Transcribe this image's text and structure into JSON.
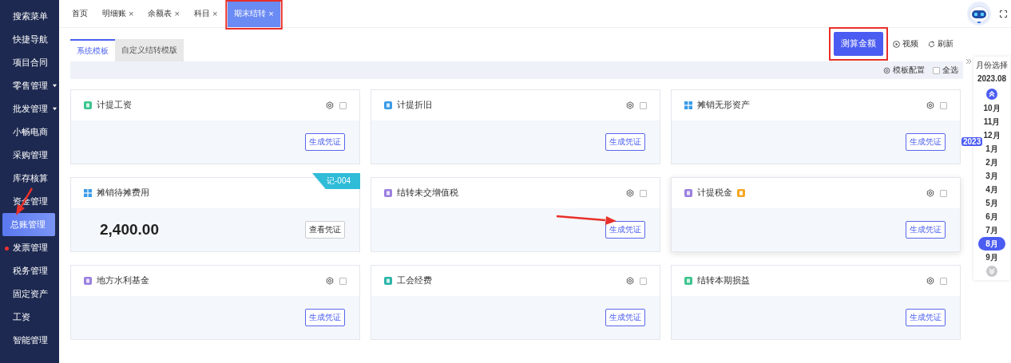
{
  "sidebar": {
    "items": [
      {
        "label": "搜索菜单",
        "selected": false,
        "expandable": false,
        "alert": false
      },
      {
        "label": "快捷导航",
        "selected": false,
        "expandable": false,
        "alert": false
      },
      {
        "label": "项目合同",
        "selected": false,
        "expandable": false,
        "alert": false
      },
      {
        "label": "零售管理",
        "selected": false,
        "expandable": true,
        "alert": false
      },
      {
        "label": "批发管理",
        "selected": false,
        "expandable": true,
        "alert": false
      },
      {
        "label": "小畅电商",
        "selected": false,
        "expandable": false,
        "alert": false
      },
      {
        "label": "采购管理",
        "selected": false,
        "expandable": false,
        "alert": false
      },
      {
        "label": "库存核算",
        "selected": false,
        "expandable": false,
        "alert": false
      },
      {
        "label": "资金管理",
        "selected": false,
        "expandable": false,
        "alert": false
      },
      {
        "label": "总账管理",
        "selected": true,
        "expandable": false,
        "alert": false
      },
      {
        "label": "发票管理",
        "selected": false,
        "expandable": false,
        "alert": true
      },
      {
        "label": "税务管理",
        "selected": false,
        "expandable": false,
        "alert": false
      },
      {
        "label": "固定资产",
        "selected": false,
        "expandable": false,
        "alert": false
      },
      {
        "label": "工资",
        "selected": false,
        "expandable": false,
        "alert": false
      },
      {
        "label": "智能管理",
        "selected": false,
        "expandable": false,
        "alert": false
      }
    ]
  },
  "tabs": [
    {
      "label": "首页",
      "selected": false,
      "closable": false
    },
    {
      "label": "明细账",
      "selected": false,
      "closable": true
    },
    {
      "label": "余额表",
      "selected": false,
      "closable": true
    },
    {
      "label": "科目",
      "selected": false,
      "closable": true
    },
    {
      "label": "期末结转",
      "selected": true,
      "closable": true
    }
  ],
  "close_glyph": "×",
  "subtabs": [
    {
      "label": "系统模板",
      "selected": true
    },
    {
      "label": "自定义结转模版",
      "selected": false
    }
  ],
  "toolbar": {
    "primary": "测算金额",
    "video": "视频",
    "refresh": "刷新",
    "config": "模板配置",
    "select_all": {
      "label": "全选",
      "checked": false
    }
  },
  "cards": [
    {
      "title": "计提工资",
      "color": "#3cc48f",
      "checked": false,
      "button": "生成凭证"
    },
    {
      "title": "计提折旧",
      "color": "#3b9be8",
      "checked": false,
      "button": "生成凭证"
    },
    {
      "title": "摊销无形资产",
      "color": "#3b9be8",
      "checked": false,
      "button": "生成凭证",
      "grid_icon": true
    },
    {
      "title": "摊销待摊费用",
      "color": "#3b9be8",
      "tag": "记-004",
      "amount": "2,400.00",
      "button": "查看凭证",
      "grid_icon": true
    },
    {
      "title": "结转未交增值税",
      "color": "#9b7fe0",
      "checked": false,
      "button": "生成凭证"
    },
    {
      "title": "计提税金",
      "color": "#9b7fe0",
      "checked": false,
      "button": "生成凭证",
      "badge": true
    },
    {
      "title": "地方水利基金",
      "color": "#9b7fe0",
      "checked": false,
      "button": "生成凭证"
    },
    {
      "title": "工会经费",
      "color": "#2bb5a8",
      "checked": false,
      "button": "生成凭证"
    },
    {
      "title": "结转本期损益",
      "color": "#3cc48f",
      "checked": false,
      "button": "生成凭证"
    }
  ],
  "month_panel": {
    "title": "月份选择",
    "current": "2023.08",
    "year_label": "2023",
    "months": [
      {
        "label": "10月",
        "selected": false
      },
      {
        "label": "11月",
        "selected": false
      },
      {
        "label": "12月",
        "selected": false
      },
      {
        "label": "1月",
        "selected": false,
        "year_start": true
      },
      {
        "label": "2月",
        "selected": false
      },
      {
        "label": "3月",
        "selected": false
      },
      {
        "label": "4月",
        "selected": false
      },
      {
        "label": "5月",
        "selected": false
      },
      {
        "label": "6月",
        "selected": false
      },
      {
        "label": "7月",
        "selected": false
      },
      {
        "label": "8月",
        "selected": true
      },
      {
        "label": "9月",
        "selected": false
      }
    ]
  }
}
